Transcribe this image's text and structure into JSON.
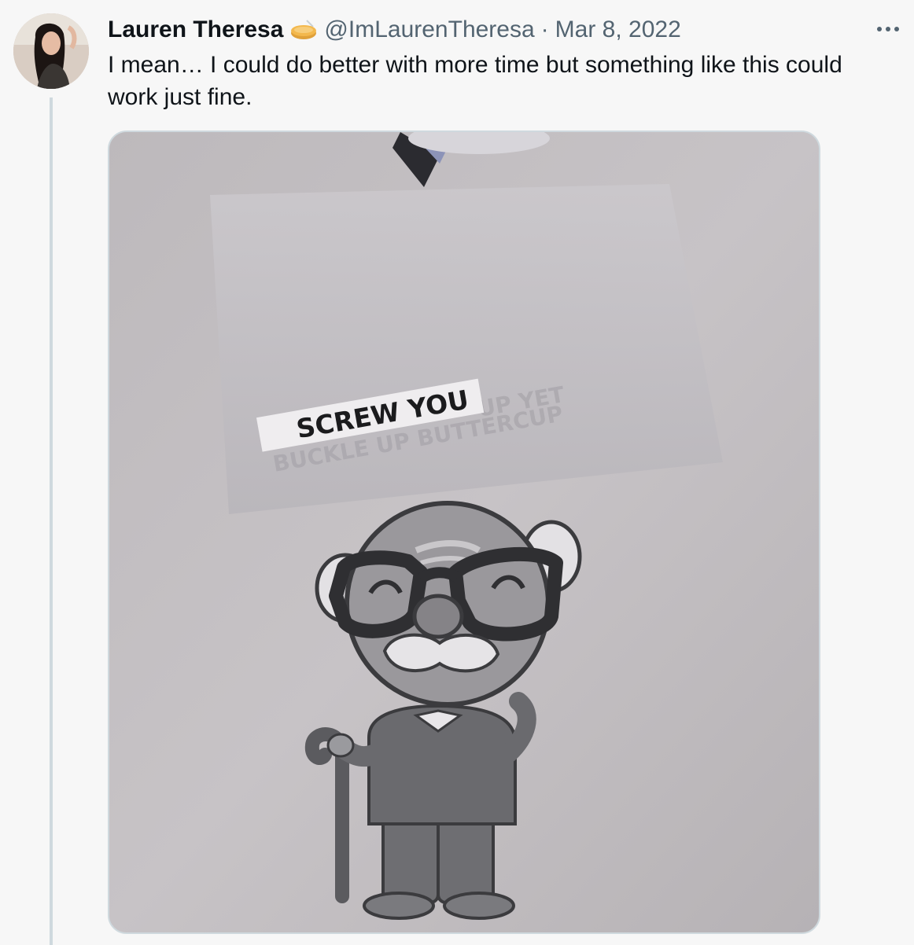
{
  "tweet": {
    "author": {
      "display_name": "Lauren Theresa",
      "handle": "@ImLaurenTheresa",
      "badge_icon": "affiliate-badge-icon"
    },
    "date": "Mar 8, 2022",
    "separator": "·",
    "text": "I mean… I could do better with more time but something like this could work just fine.",
    "media": {
      "sign_text": "SCREW YOU"
    },
    "more_icon": "more-dots-icon"
  },
  "colors": {
    "background": "#f7f7f7",
    "text_primary": "#0f1419",
    "text_secondary": "#536471",
    "border": "#cfd9de"
  }
}
